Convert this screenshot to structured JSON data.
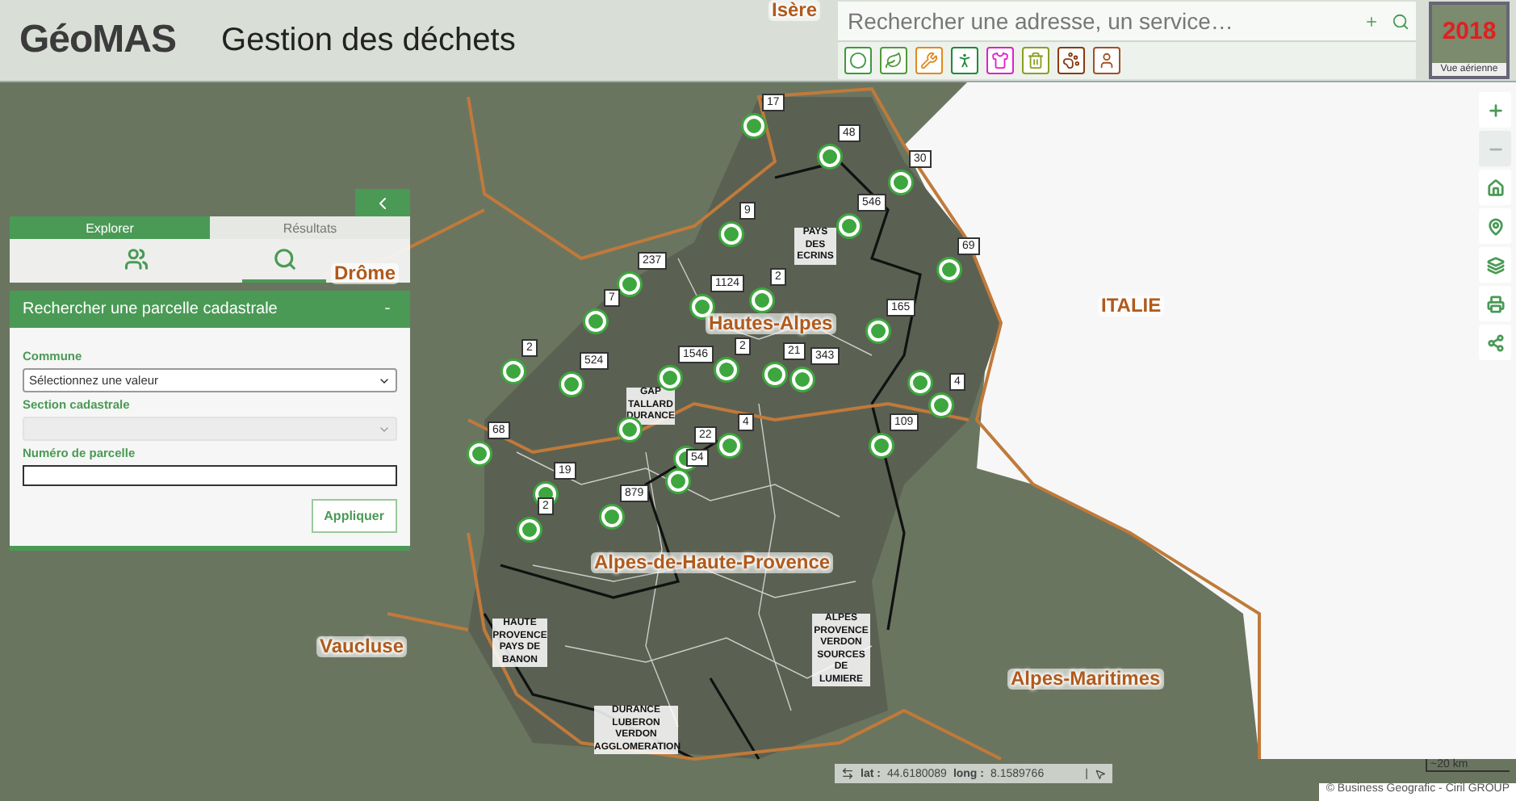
{
  "header": {
    "logo": "GéoMAS",
    "title": "Gestion des déchets"
  },
  "search": {
    "placeholder": "Rechercher une adresse, un service…"
  },
  "filters": [
    {
      "color": "#3d9a3d"
    },
    {
      "color": "#4f9a3a"
    },
    {
      "color": "#e08a1e"
    },
    {
      "color": "#1f8a3a"
    },
    {
      "color": "#e020c8"
    },
    {
      "color": "#8aa020"
    },
    {
      "color": "#8a3a10"
    },
    {
      "color": "#a0502a"
    }
  ],
  "basemap": {
    "year": "2018",
    "label": "Vue aérienne"
  },
  "panel": {
    "tabs": [
      {
        "label": "Explorer",
        "selected": true
      },
      {
        "label": "Résultats",
        "selected": false
      }
    ],
    "tools": [
      {
        "selected": false
      },
      {
        "selected": true
      }
    ],
    "section": {
      "title": "Rechercher une parcelle cadastrale",
      "toggle": "-"
    },
    "fields": [
      {
        "kind": "select",
        "label": "Commune",
        "value": "Sélectionnez une valeur",
        "disabled": false
      },
      {
        "kind": "select",
        "label": "Section cadastrale",
        "disabled": true
      },
      {
        "kind": "input",
        "label": "Numéro de parcelle"
      }
    ],
    "submit": "Appliquer"
  },
  "map": {
    "regions": [
      "Isère",
      "Drôme",
      "ITALIE",
      "Hautes-Alpes",
      "Alpes-de-Haute-Provence",
      "Vaucluse",
      "Alpes-Maritimes"
    ],
    "zones": [
      "PAYS DES ECRINS",
      "GAP TALLARD DURANCE",
      "HAUTE PROVENCE PAYS DE BANON",
      "DURANCE LUBERON VERDON AGGLOMERATION",
      "ALPES PROVENCE VERDON SOURCES DE LUMIERE"
    ],
    "markers": [
      {
        "kind": "counted",
        "count": "17"
      },
      {
        "kind": "counted",
        "count": "48"
      },
      {
        "kind": "counted",
        "count": "30"
      },
      {
        "kind": "counted",
        "count": "9"
      },
      {
        "kind": "counted",
        "count": "546"
      },
      {
        "kind": "counted",
        "count": "69"
      },
      {
        "kind": "counted",
        "count": "237"
      },
      {
        "kind": "counted",
        "count": "1124"
      },
      {
        "kind": "counted",
        "count": "2"
      },
      {
        "kind": "counted",
        "count": "7"
      },
      {
        "kind": "counted",
        "count": "165"
      },
      {
        "kind": "counted",
        "count": "2"
      },
      {
        "kind": "counted",
        "count": "524"
      },
      {
        "kind": "counted",
        "count": "1546"
      },
      {
        "kind": "counted",
        "count": "2"
      },
      {
        "kind": "counted",
        "count": "21"
      },
      {
        "kind": "counted",
        "count": "343"
      },
      {
        "kind": "plain"
      },
      {
        "kind": "counted",
        "count": "4"
      },
      {
        "kind": "counted",
        "count": "68"
      },
      {
        "kind": "counted",
        "count": "4"
      },
      {
        "kind": "counted",
        "count": "22"
      },
      {
        "kind": "plain"
      },
      {
        "kind": "counted",
        "count": "109"
      },
      {
        "kind": "counted",
        "count": "54"
      },
      {
        "kind": "counted",
        "count": "19"
      },
      {
        "kind": "counted",
        "count": "879"
      },
      {
        "kind": "counted",
        "count": "2"
      }
    ]
  },
  "map_tools": [
    {
      "disabled": false
    },
    {
      "disabled": true
    },
    {
      "disabled": false
    },
    {
      "disabled": false
    },
    {
      "disabled": false
    },
    {
      "disabled": false
    },
    {
      "disabled": false
    }
  ],
  "coordinates": {
    "lat_label": "lat :",
    "lat": "44.6180089",
    "long_label": "long :",
    "long": "8.1589766",
    "separator": "|"
  },
  "scale": "~20 km",
  "attribution": "© Business Geografic - Ciril GROUP"
}
